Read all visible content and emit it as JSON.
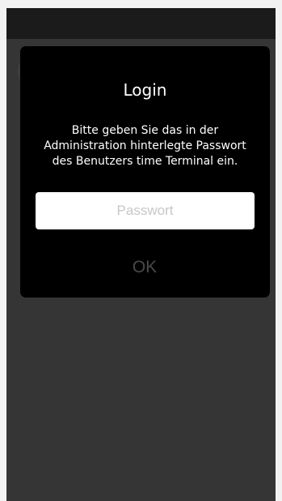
{
  "dialog": {
    "title": "Login",
    "message": "Bitte geben Sie das in der Administration hinterlegte Passwort des Benutzers  time Terminal ein.",
    "password_field": {
      "placeholder": "Passwort",
      "value": ""
    },
    "ok_label": "OK"
  },
  "colors": {
    "dialog_background": "#000000",
    "backdrop": "#353535",
    "ok_disabled": "#4a4a4a",
    "input_background": "#ffffff",
    "placeholder": "#c7c7c7"
  }
}
